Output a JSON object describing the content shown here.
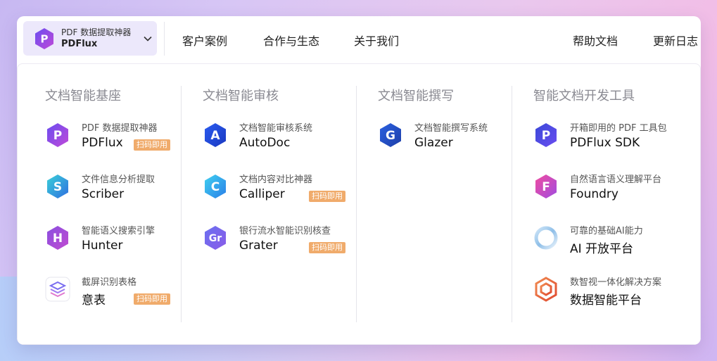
{
  "header": {
    "brand_sub": "PDF 数据提取神器",
    "brand_name": "PDFlux",
    "nav": [
      "客户案例",
      "合作与生态",
      "关于我们",
      "帮助文档",
      "更新日志"
    ]
  },
  "columns": [
    {
      "title": "文档智能基座",
      "items": [
        {
          "desc": "PDF 数据提取神器",
          "title": "PDFlux",
          "tag": "扫码即用",
          "icon": "pdflux-icon",
          "letter": "P"
        },
        {
          "desc": "文件信息分析提取",
          "title": "Scriber",
          "icon": "scriber-icon",
          "letter": "S"
        },
        {
          "desc": "智能语义搜索引擎",
          "title": "Hunter",
          "icon": "hunter-icon",
          "letter": "H"
        },
        {
          "desc": "截屏识别表格",
          "title": "意表",
          "tag": "扫码即用",
          "icon": "layers-icon"
        }
      ]
    },
    {
      "title": "文档智能审核",
      "items": [
        {
          "desc": "文档智能审核系统",
          "title": "AutoDoc",
          "icon": "autodoc-icon",
          "letter": "A"
        },
        {
          "desc": "文档内容对比神器",
          "title": "Calliper",
          "tag": "扫码即用",
          "icon": "calliper-icon",
          "letter": "C"
        },
        {
          "desc": "银行流水智能识别核查",
          "title": "Grater",
          "tag": "扫码即用",
          "icon": "grater-icon",
          "letter": "Gr"
        }
      ]
    },
    {
      "title": "文档智能撰写",
      "items": [
        {
          "desc": "文档智能撰写系统",
          "title": "Glazer",
          "icon": "glazer-icon",
          "letter": "G"
        }
      ]
    },
    {
      "title": "智能文档开发工具",
      "items": [
        {
          "desc": "开箱即用的 PDF 工具包",
          "title": "PDFlux SDK",
          "icon": "pdflux-sdk-icon",
          "letter": "P"
        },
        {
          "desc": "自然语言语义理解平台",
          "title": "Foundry",
          "icon": "foundry-icon",
          "letter": "F"
        },
        {
          "desc": "可靠的基础AI能力",
          "title": "AI 开放平台",
          "icon": "ring-icon"
        },
        {
          "desc": "数智视一体化解决方案",
          "title": "数据智能平台",
          "icon": "cube-icon"
        }
      ]
    }
  ],
  "colors": {
    "tag": "#f0ab6b",
    "brand_bg": "#ece8fb",
    "pdflux": [
      "#6a4cf0",
      "#c04ad8"
    ],
    "scriber": [
      "#3ad0d8",
      "#2f6fe0"
    ],
    "hunter": [
      "#8a4fe0",
      "#c04ad0"
    ],
    "autodoc": [
      "#2b5cf0",
      "#1a38c0"
    ],
    "calliper": [
      "#40d0f0",
      "#2a7fe8"
    ],
    "grater": [
      "#6a70f0",
      "#8a5ce8"
    ],
    "glazer": [
      "#2a60e0",
      "#1e3fa8"
    ],
    "foundry": [
      "#f04ca0",
      "#a04ce0"
    ],
    "cube": [
      "#f07040",
      "#e04a30"
    ]
  }
}
